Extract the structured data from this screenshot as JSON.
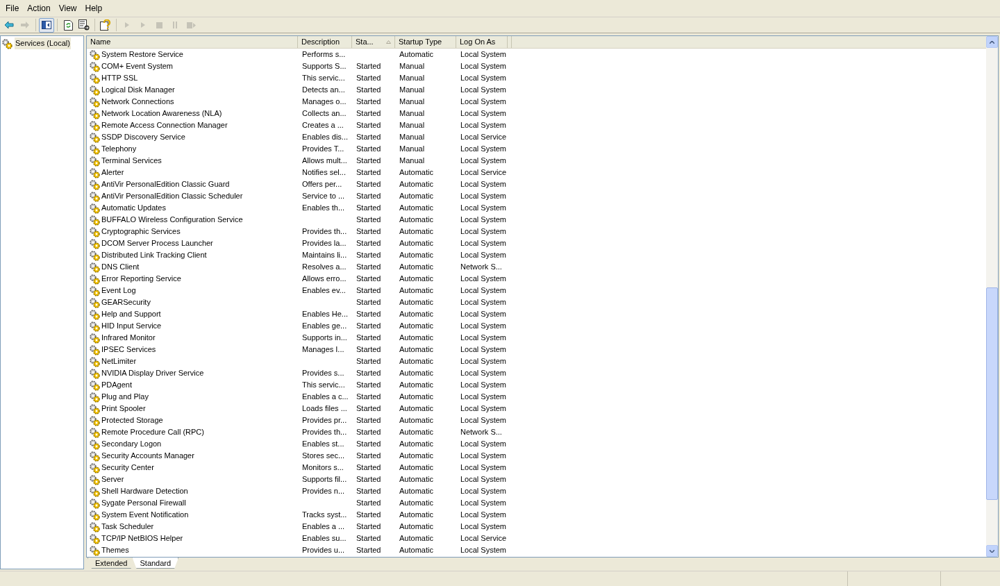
{
  "menu": [
    "File",
    "Action",
    "View",
    "Help"
  ],
  "toolbar": [
    {
      "kind": "back",
      "disabled": false,
      "pressed": false
    },
    {
      "kind": "forward",
      "disabled": true,
      "pressed": false
    },
    {
      "kind": "console-tree",
      "disabled": false,
      "pressed": true
    },
    {
      "kind": "refresh",
      "disabled": false,
      "pressed": false
    },
    {
      "kind": "export",
      "disabled": false,
      "pressed": false
    },
    {
      "kind": "help",
      "disabled": false,
      "pressed": false
    },
    {
      "kind": "play",
      "disabled": true,
      "pressed": false
    },
    {
      "kind": "play",
      "disabled": true,
      "pressed": false
    },
    {
      "kind": "stop",
      "disabled": true,
      "pressed": false
    },
    {
      "kind": "pause",
      "disabled": true,
      "pressed": false
    },
    {
      "kind": "restart",
      "disabled": true,
      "pressed": false
    }
  ],
  "tree": {
    "label": "Services (Local)"
  },
  "table": {
    "columns": [
      {
        "label": "Name",
        "sorted": false
      },
      {
        "label": "Description",
        "sorted": false
      },
      {
        "label": "Sta...",
        "sorted": true
      },
      {
        "label": "Startup Type",
        "sorted": false
      },
      {
        "label": "Log On As",
        "sorted": false
      }
    ],
    "rows": [
      {
        "name": "System Restore Service",
        "description": "Performs s...",
        "startup_type": "Automatic",
        "log_on_as": "Local System"
      },
      {
        "name": "COM+ Event System",
        "description": "Supports S...",
        "status": "Started",
        "startup_type": "Manual",
        "log_on_as": "Local System"
      },
      {
        "name": "HTTP SSL",
        "description": "This servic...",
        "status": "Started",
        "startup_type": "Manual",
        "log_on_as": "Local System"
      },
      {
        "name": "Logical Disk Manager",
        "description": "Detects an...",
        "status": "Started",
        "startup_type": "Manual",
        "log_on_as": "Local System"
      },
      {
        "name": "Network Connections",
        "description": "Manages o...",
        "status": "Started",
        "startup_type": "Manual",
        "log_on_as": "Local System"
      },
      {
        "name": "Network Location Awareness (NLA)",
        "description": "Collects an...",
        "status": "Started",
        "startup_type": "Manual",
        "log_on_as": "Local System"
      },
      {
        "name": "Remote Access Connection Manager",
        "description": "Creates a ...",
        "status": "Started",
        "startup_type": "Manual",
        "log_on_as": "Local System"
      },
      {
        "name": "SSDP Discovery Service",
        "description": "Enables dis...",
        "status": "Started",
        "startup_type": "Manual",
        "log_on_as": "Local Service"
      },
      {
        "name": "Telephony",
        "description": "Provides T...",
        "status": "Started",
        "startup_type": "Manual",
        "log_on_as": "Local System"
      },
      {
        "name": "Terminal Services",
        "description": "Allows mult...",
        "status": "Started",
        "startup_type": "Manual",
        "log_on_as": "Local System"
      },
      {
        "name": "Alerter",
        "description": "Notifies sel...",
        "status": "Started",
        "startup_type": "Automatic",
        "log_on_as": "Local Service"
      },
      {
        "name": "AntiVir PersonalEdition Classic Guard",
        "description": "Offers per...",
        "status": "Started",
        "startup_type": "Automatic",
        "log_on_as": "Local System"
      },
      {
        "name": "AntiVir PersonalEdition Classic Scheduler",
        "description": "Service to ...",
        "status": "Started",
        "startup_type": "Automatic",
        "log_on_as": "Local System"
      },
      {
        "name": "Automatic Updates",
        "description": "Enables th...",
        "status": "Started",
        "startup_type": "Automatic",
        "log_on_as": "Local System"
      },
      {
        "name": "BUFFALO Wireless Configuration Service",
        "status": "Started",
        "startup_type": "Automatic",
        "log_on_as": "Local System"
      },
      {
        "name": "Cryptographic Services",
        "description": "Provides th...",
        "status": "Started",
        "startup_type": "Automatic",
        "log_on_as": "Local System"
      },
      {
        "name": "DCOM Server Process Launcher",
        "description": "Provides la...",
        "status": "Started",
        "startup_type": "Automatic",
        "log_on_as": "Local System"
      },
      {
        "name": "Distributed Link Tracking Client",
        "description": "Maintains li...",
        "status": "Started",
        "startup_type": "Automatic",
        "log_on_as": "Local System"
      },
      {
        "name": "DNS Client",
        "description": "Resolves a...",
        "status": "Started",
        "startup_type": "Automatic",
        "log_on_as": "Network S..."
      },
      {
        "name": "Error Reporting Service",
        "description": "Allows erro...",
        "status": "Started",
        "startup_type": "Automatic",
        "log_on_as": "Local System"
      },
      {
        "name": "Event Log",
        "description": "Enables ev...",
        "status": "Started",
        "startup_type": "Automatic",
        "log_on_as": "Local System"
      },
      {
        "name": "GEARSecurity",
        "status": "Started",
        "startup_type": "Automatic",
        "log_on_as": "Local System"
      },
      {
        "name": "Help and Support",
        "description": "Enables He...",
        "status": "Started",
        "startup_type": "Automatic",
        "log_on_as": "Local System"
      },
      {
        "name": "HID Input Service",
        "description": "Enables ge...",
        "status": "Started",
        "startup_type": "Automatic",
        "log_on_as": "Local System"
      },
      {
        "name": "Infrared Monitor",
        "description": "Supports in...",
        "status": "Started",
        "startup_type": "Automatic",
        "log_on_as": "Local System"
      },
      {
        "name": "IPSEC Services",
        "description": "Manages I...",
        "status": "Started",
        "startup_type": "Automatic",
        "log_on_as": "Local System"
      },
      {
        "name": "NetLimiter",
        "status": "Started",
        "startup_type": "Automatic",
        "log_on_as": "Local System"
      },
      {
        "name": "NVIDIA Display Driver Service",
        "description": "Provides s...",
        "status": "Started",
        "startup_type": "Automatic",
        "log_on_as": "Local System"
      },
      {
        "name": "PDAgent",
        "description": "This servic...",
        "status": "Started",
        "startup_type": "Automatic",
        "log_on_as": "Local System"
      },
      {
        "name": "Plug and Play",
        "description": "Enables a c...",
        "status": "Started",
        "startup_type": "Automatic",
        "log_on_as": "Local System"
      },
      {
        "name": "Print Spooler",
        "description": "Loads files ...",
        "status": "Started",
        "startup_type": "Automatic",
        "log_on_as": "Local System"
      },
      {
        "name": "Protected Storage",
        "description": "Provides pr...",
        "status": "Started",
        "startup_type": "Automatic",
        "log_on_as": "Local System"
      },
      {
        "name": "Remote Procedure Call (RPC)",
        "description": "Provides th...",
        "status": "Started",
        "startup_type": "Automatic",
        "log_on_as": "Network S..."
      },
      {
        "name": "Secondary Logon",
        "description": "Enables st...",
        "status": "Started",
        "startup_type": "Automatic",
        "log_on_as": "Local System"
      },
      {
        "name": "Security Accounts Manager",
        "description": "Stores sec...",
        "status": "Started",
        "startup_type": "Automatic",
        "log_on_as": "Local System"
      },
      {
        "name": "Security Center",
        "description": "Monitors s...",
        "status": "Started",
        "startup_type": "Automatic",
        "log_on_as": "Local System"
      },
      {
        "name": "Server",
        "description": "Supports fil...",
        "status": "Started",
        "startup_type": "Automatic",
        "log_on_as": "Local System"
      },
      {
        "name": "Shell Hardware Detection",
        "description": "Provides n...",
        "status": "Started",
        "startup_type": "Automatic",
        "log_on_as": "Local System"
      },
      {
        "name": "Sygate Personal Firewall",
        "status": "Started",
        "startup_type": "Automatic",
        "log_on_as": "Local System"
      },
      {
        "name": "System Event Notification",
        "description": "Tracks syst...",
        "status": "Started",
        "startup_type": "Automatic",
        "log_on_as": "Local System"
      },
      {
        "name": "Task Scheduler",
        "description": "Enables a ...",
        "status": "Started",
        "startup_type": "Automatic",
        "log_on_as": "Local System"
      },
      {
        "name": "TCP/IP NetBIOS Helper",
        "description": "Enables su...",
        "status": "Started",
        "startup_type": "Automatic",
        "log_on_as": "Local Service"
      },
      {
        "name": "Themes",
        "description": "Provides u...",
        "status": "Started",
        "startup_type": "Automatic",
        "log_on_as": "Local System"
      }
    ]
  },
  "tabs": [
    {
      "label": "Extended",
      "selected": false
    },
    {
      "label": "Standard",
      "selected": true
    }
  ]
}
